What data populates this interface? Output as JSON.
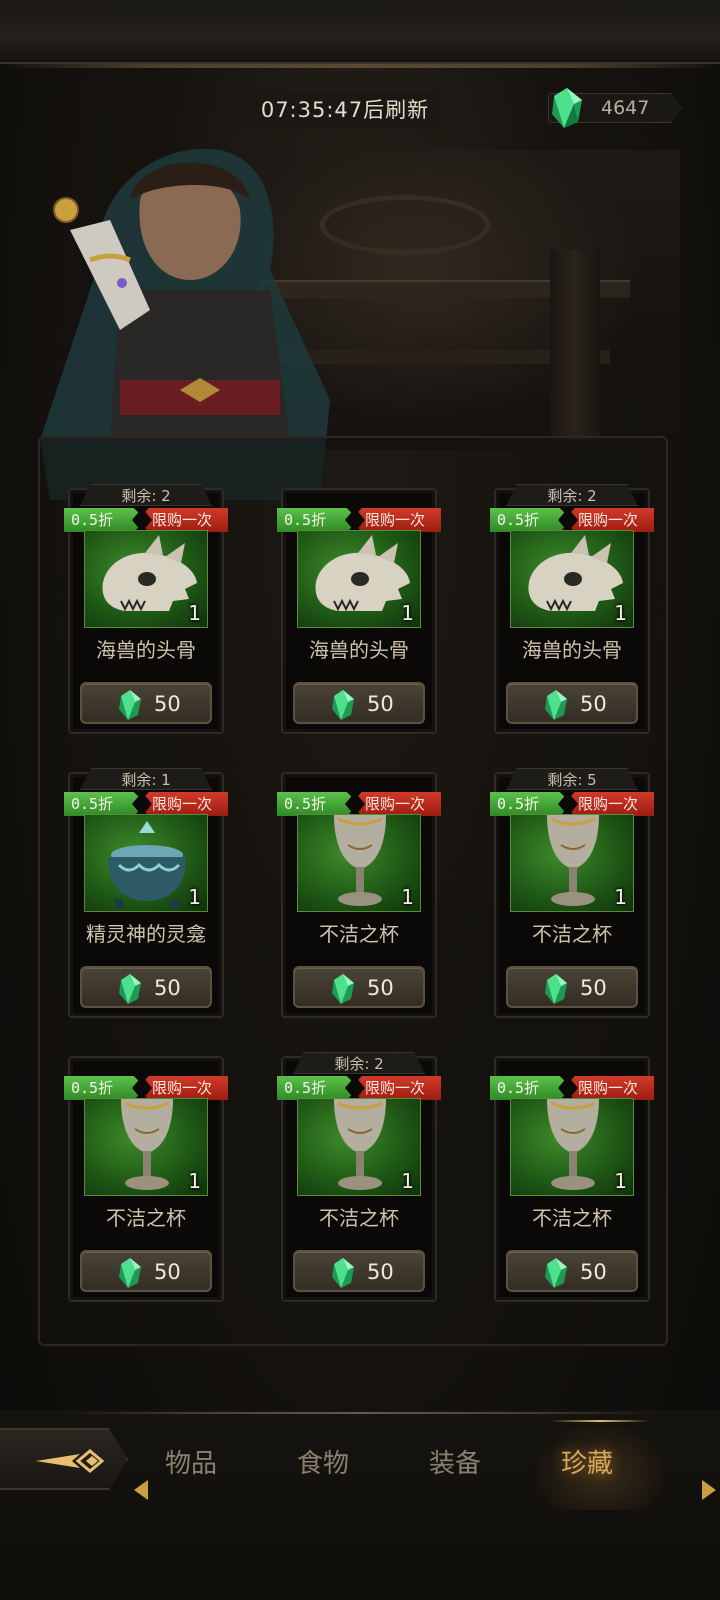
{
  "header": {
    "refresh_timer": "07:35:47后刷新",
    "currency_amount": "4647",
    "currency_icon": "green-crystal-icon"
  },
  "shop": {
    "cards": [
      {
        "remain": "剩余: 2",
        "discount": "0.5折",
        "limit": "限购一次",
        "item": "海兽的头骨",
        "icon": "sea-beast-skull-icon",
        "qty": "1",
        "price": "50"
      },
      {
        "remain": "",
        "discount": "0.5折",
        "limit": "限购一次",
        "item": "海兽的头骨",
        "icon": "sea-beast-skull-icon",
        "qty": "1",
        "price": "50"
      },
      {
        "remain": "剩余: 2",
        "discount": "0.5折",
        "limit": "限购一次",
        "item": "海兽的头骨",
        "icon": "sea-beast-skull-icon",
        "qty": "1",
        "price": "50"
      },
      {
        "remain": "剩余: 1",
        "discount": "0.5折",
        "limit": "限购一次",
        "item": "精灵神的灵龛",
        "icon": "spirit-shrine-icon",
        "qty": "1",
        "price": "50"
      },
      {
        "remain": "",
        "discount": "0.5折",
        "limit": "限购一次",
        "item": "不洁之杯",
        "icon": "unclean-goblet-icon",
        "qty": "1",
        "price": "50"
      },
      {
        "remain": "剩余: 5",
        "discount": "0.5折",
        "limit": "限购一次",
        "item": "不洁之杯",
        "icon": "unclean-goblet-icon",
        "qty": "1",
        "price": "50"
      },
      {
        "remain": "",
        "discount": "0.5折",
        "limit": "限购一次",
        "item": "不洁之杯",
        "icon": "unclean-goblet-icon",
        "qty": "1",
        "price": "50"
      },
      {
        "remain": "剩余: 2",
        "discount": "0.5折",
        "limit": "限购一次",
        "item": "不洁之杯",
        "icon": "unclean-goblet-icon",
        "qty": "1",
        "price": "50"
      },
      {
        "remain": "",
        "discount": "0.5折",
        "limit": "限购一次",
        "item": "不洁之杯",
        "icon": "unclean-goblet-icon",
        "qty": "1",
        "price": "50"
      }
    ]
  },
  "nav": {
    "tabs": [
      "物品",
      "食物",
      "装备",
      "珍藏"
    ],
    "active_tab": "珍藏",
    "accent_color": "#d6a95a"
  },
  "colors": {
    "discount_green": "#3f9e30",
    "limit_red": "#b8281a",
    "gem_green": "#3fd07a"
  }
}
